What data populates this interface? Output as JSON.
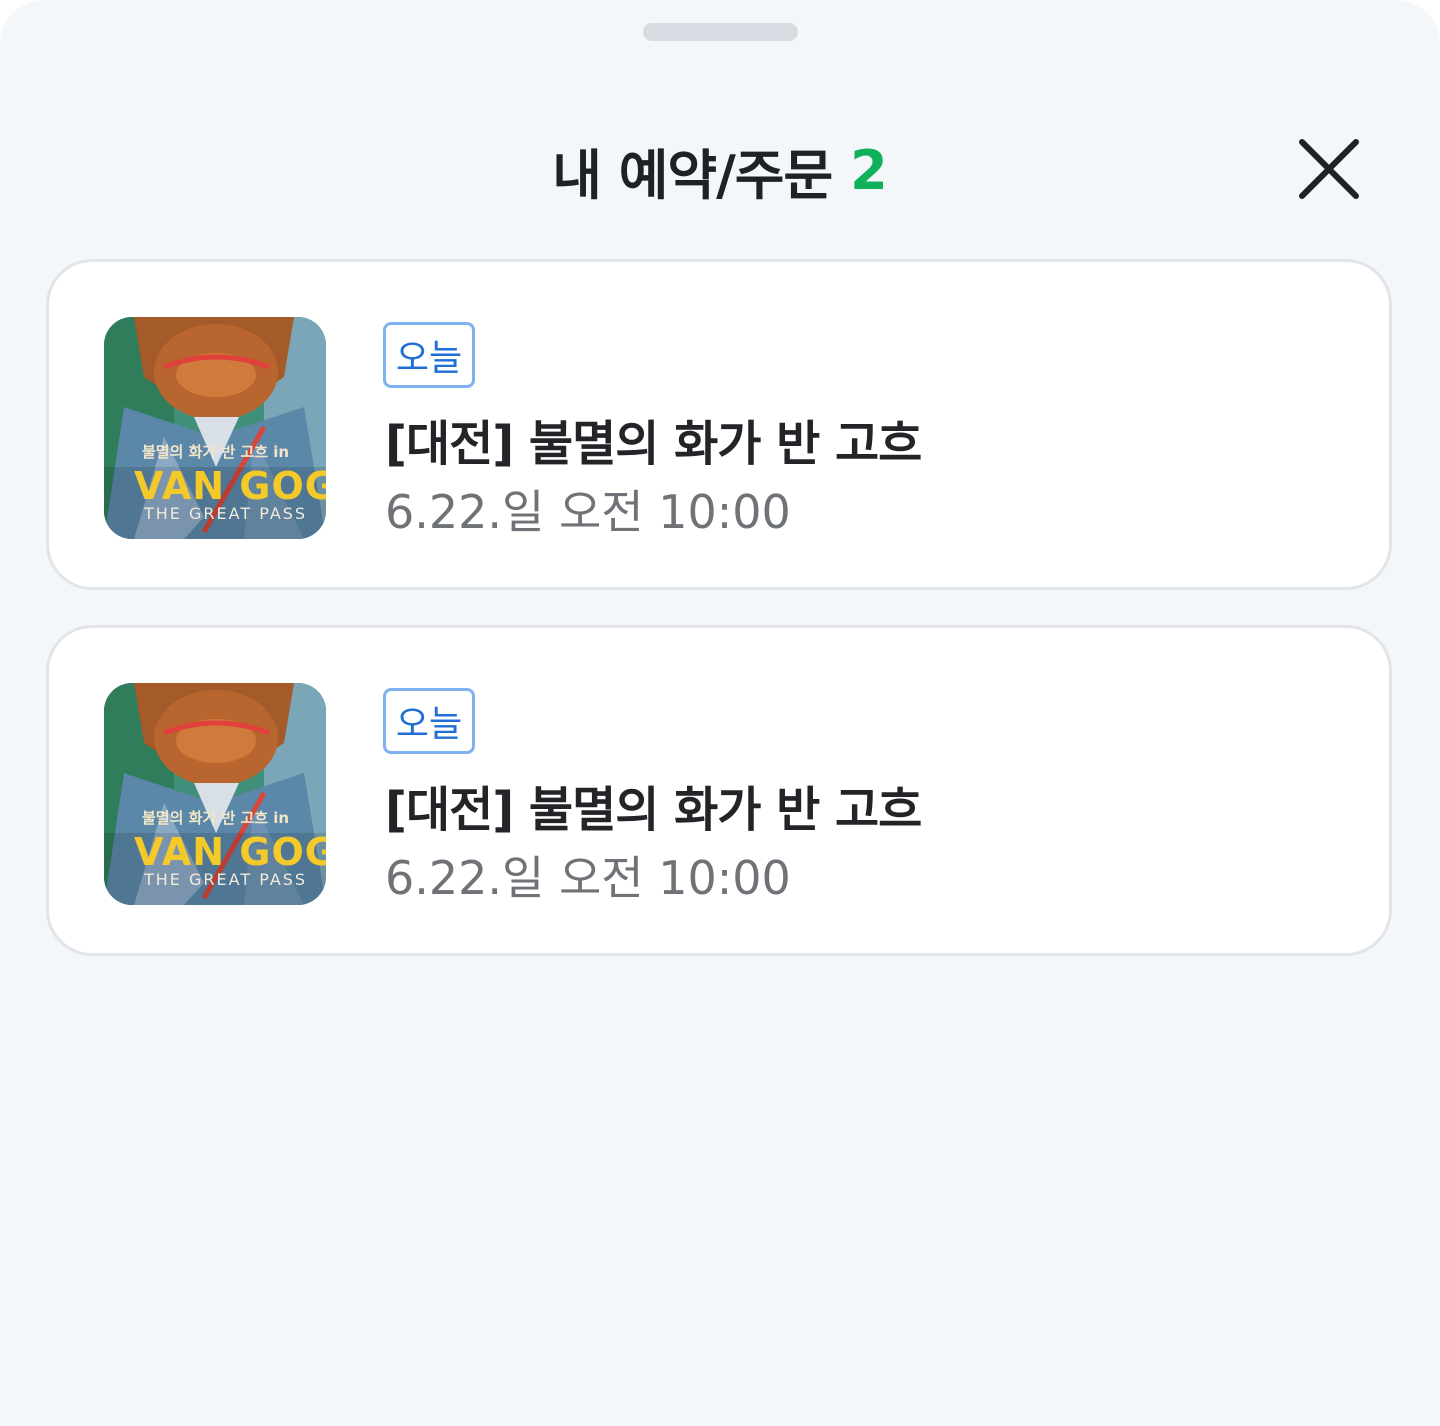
{
  "header": {
    "title": "내 예약/주문",
    "count": "2"
  },
  "bookings": [
    {
      "badge": "오늘",
      "title": "[대전] 불멸의 화가 반 고흐",
      "datetime": "6.22.일 오전 10:00",
      "poster": {
        "ko_title": "불멸의 화가 반 고흐 in",
        "main_title": "VAN GOG",
        "subtitle": "THE GREAT PASS"
      }
    },
    {
      "badge": "오늘",
      "title": "[대전] 불멸의 화가 반 고흐",
      "datetime": "6.22.일 오전 10:00",
      "poster": {
        "ko_title": "불멸의 화가 반 고흐 in",
        "main_title": "VAN GOG",
        "subtitle": "THE GREAT PASS"
      }
    }
  ],
  "colors": {
    "sheet_bg": "#f3f7fa",
    "count_green": "#11b05a",
    "badge_blue": "#1f6fd6",
    "badge_border": "#7fb2f0"
  },
  "icons": {
    "close": "close-icon",
    "grabber": "drag-handle"
  }
}
